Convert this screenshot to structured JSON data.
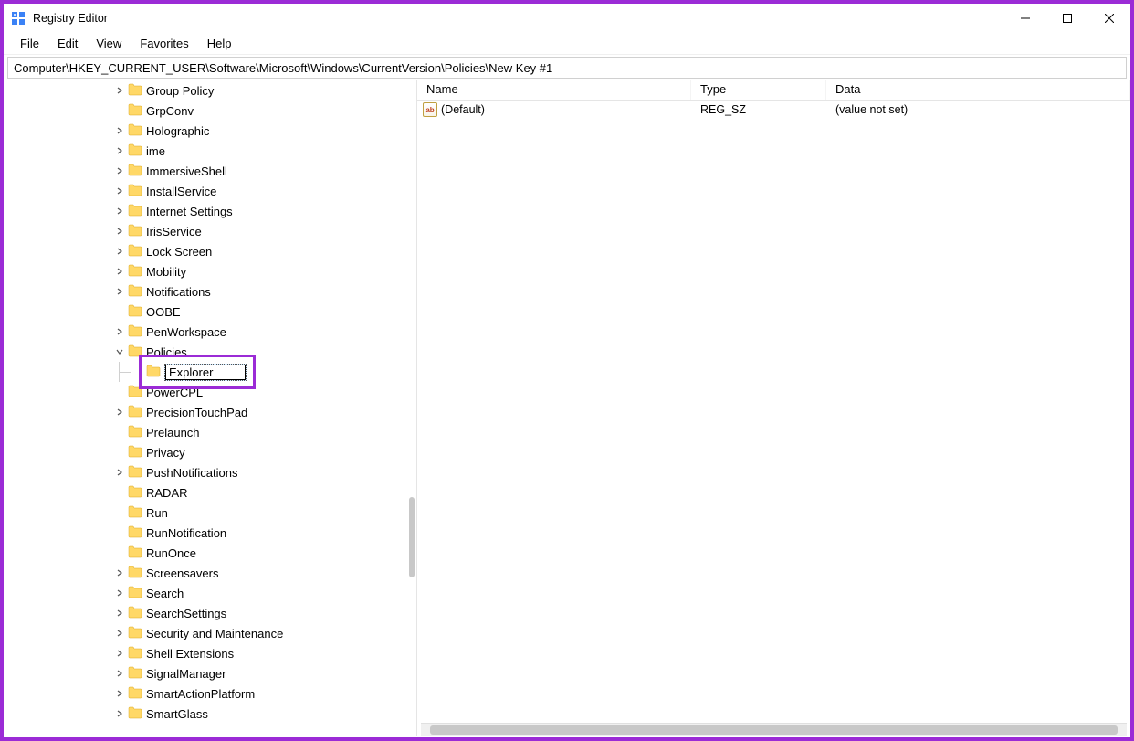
{
  "window": {
    "title": "Registry Editor"
  },
  "menu": {
    "file": "File",
    "edit": "Edit",
    "view": "View",
    "favorites": "Favorites",
    "help": "Help"
  },
  "address": "Computer\\HKEY_CURRENT_USER\\Software\\Microsoft\\Windows\\CurrentVersion\\Policies\\New Key #1",
  "tree": {
    "items": [
      {
        "label": "Group Policy",
        "expandable": true
      },
      {
        "label": "GrpConv",
        "expandable": false
      },
      {
        "label": "Holographic",
        "expandable": true
      },
      {
        "label": "ime",
        "expandable": true
      },
      {
        "label": "ImmersiveShell",
        "expandable": true
      },
      {
        "label": "InstallService",
        "expandable": true
      },
      {
        "label": "Internet Settings",
        "expandable": true
      },
      {
        "label": "IrisService",
        "expandable": true
      },
      {
        "label": "Lock Screen",
        "expandable": true
      },
      {
        "label": "Mobility",
        "expandable": true
      },
      {
        "label": "Notifications",
        "expandable": true
      },
      {
        "label": "OOBE",
        "expandable": false
      },
      {
        "label": "PenWorkspace",
        "expandable": true
      },
      {
        "label": "Policies",
        "expandable": true,
        "expanded": true,
        "child_editing": "Explorer"
      },
      {
        "label": "PowerCPL",
        "expandable": false
      },
      {
        "label": "PrecisionTouchPad",
        "expandable": true
      },
      {
        "label": "Prelaunch",
        "expandable": false
      },
      {
        "label": "Privacy",
        "expandable": false
      },
      {
        "label": "PushNotifications",
        "expandable": true
      },
      {
        "label": "RADAR",
        "expandable": false
      },
      {
        "label": "Run",
        "expandable": false
      },
      {
        "label": "RunNotification",
        "expandable": false
      },
      {
        "label": "RunOnce",
        "expandable": false
      },
      {
        "label": "Screensavers",
        "expandable": true
      },
      {
        "label": "Search",
        "expandable": true
      },
      {
        "label": "SearchSettings",
        "expandable": true
      },
      {
        "label": "Security and Maintenance",
        "expandable": true
      },
      {
        "label": "Shell Extensions",
        "expandable": true
      },
      {
        "label": "SignalManager",
        "expandable": true
      },
      {
        "label": "SmartActionPlatform",
        "expandable": true
      },
      {
        "label": "SmartGlass",
        "expandable": true
      }
    ]
  },
  "columns": {
    "name": "Name",
    "type": "Type",
    "data": "Data"
  },
  "values": [
    {
      "name": "(Default)",
      "type": "REG_SZ",
      "data": "(value not set)"
    }
  ]
}
